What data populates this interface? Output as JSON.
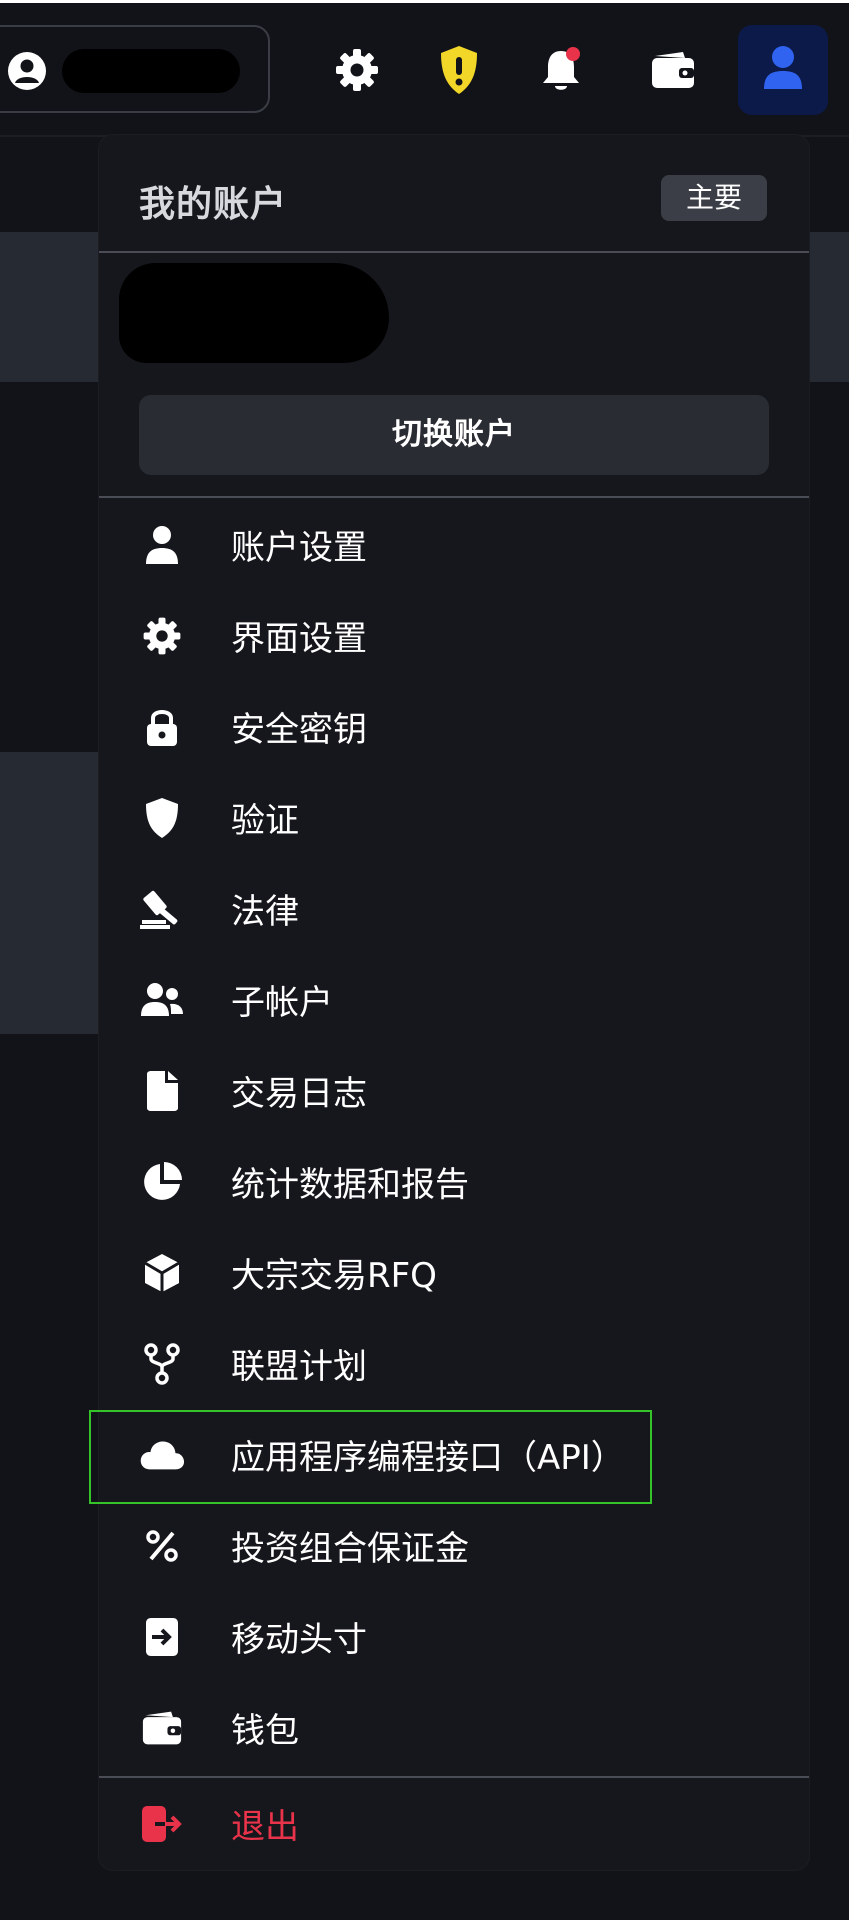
{
  "colors": {
    "background": "#121318",
    "menu_background": "#16171c",
    "logout_red": "#e8334a",
    "shield_yellow": "#f2d729",
    "notification_dot": "#e8334a",
    "profile_blue": "#2f63f0",
    "highlight_green": "#34c42a"
  },
  "topbar": {
    "icons": [
      "user-circle-icon",
      "gear-icon",
      "shield-alert-icon",
      "bell-icon",
      "wallet-icon",
      "user-icon"
    ]
  },
  "menu": {
    "title": "我的账户",
    "badge": "主要",
    "switch_label": "切换账户",
    "items": [
      {
        "icon": "user-icon",
        "label": "账户设置"
      },
      {
        "icon": "gear-icon",
        "label": "界面设置"
      },
      {
        "icon": "lock-icon",
        "label": "安全密钥"
      },
      {
        "icon": "shield-icon",
        "label": "验证"
      },
      {
        "icon": "gavel-icon",
        "label": "法律"
      },
      {
        "icon": "users-icon",
        "label": "子帐户"
      },
      {
        "icon": "file-icon",
        "label": "交易日志"
      },
      {
        "icon": "pie-chart-icon",
        "label": "统计数据和报告"
      },
      {
        "icon": "cube-icon",
        "label": "大宗交易RFQ"
      },
      {
        "icon": "branch-icon",
        "label": "联盟计划"
      },
      {
        "icon": "cloud-icon",
        "label": "应用程序编程接口（API）"
      },
      {
        "icon": "percent-icon",
        "label": "投资组合保证金"
      },
      {
        "icon": "transfer-icon",
        "label": "移动头寸"
      },
      {
        "icon": "wallet-icon",
        "label": "钱包"
      }
    ],
    "logout": {
      "icon": "logout-icon",
      "label": "退出"
    }
  }
}
